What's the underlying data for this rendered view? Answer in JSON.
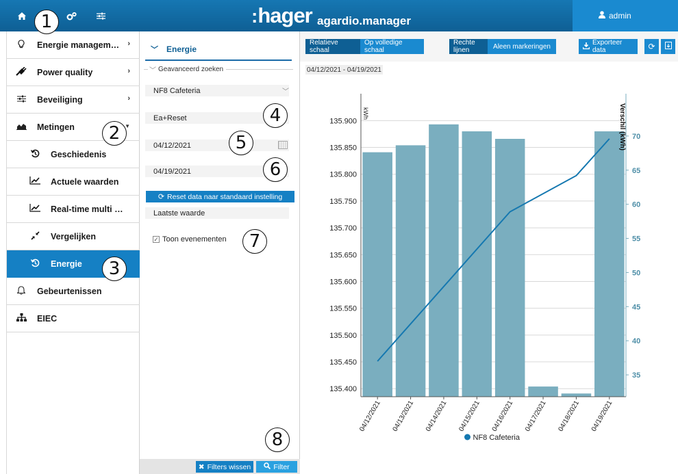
{
  "app": {
    "brand": "hager",
    "brand_colon": ":",
    "product": "agardio.manager",
    "user": "admin"
  },
  "topbar": {
    "icons": [
      "home-icon",
      "cogs-icon",
      "sliders-icon"
    ]
  },
  "sidebar": {
    "items": [
      {
        "label": "Energie managem…",
        "icon": "bulb-icon",
        "has_chevron": true
      },
      {
        "label": "Power quality",
        "icon": "plug-icon",
        "has_chevron": true
      },
      {
        "label": "Beveiliging",
        "icon": "sliders-icon",
        "has_chevron": true
      },
      {
        "label": "Metingen",
        "icon": "area-chart-icon",
        "has_chevron": true
      },
      {
        "label": "Geschiedenis",
        "icon": "history-icon"
      },
      {
        "label": "Actuele waarden",
        "icon": "line-chart-icon"
      },
      {
        "label": "Real-time multi …",
        "icon": "line-chart-icon"
      },
      {
        "label": "Vergelijken",
        "icon": "compress-icon"
      },
      {
        "label": "Energie",
        "icon": "history-icon",
        "active": true
      },
      {
        "label": "Gebeurtenissen",
        "icon": "bell-icon"
      },
      {
        "label": "EIEC",
        "icon": "sitemap-icon"
      }
    ]
  },
  "filter": {
    "title": "Energie",
    "advanced_search": "Geavanceerd zoeken",
    "device": "NF8 Cafeteria",
    "measure": "Ea+Reset",
    "start_date": "04/12/2021",
    "end_date": "04/19/2021",
    "reset_label": "Reset data naar standaard instelling",
    "value_mode": "Laatste waarde",
    "show_events_label": "Toon evenementen",
    "show_events_checked": true,
    "clear_label": "Filters wissen",
    "apply_label": "Filter"
  },
  "toolbar": {
    "relative_scale": "Relatieve schaal",
    "full_scale": "Op volledige schaal",
    "straight_lines": "Rechte lijnen",
    "markers_only": "Aleen markeringen",
    "export_label": "Exporteer data"
  },
  "date_range": "04/12/2021 - 04/19/2021",
  "callouts": [
    "1",
    "2",
    "3",
    "4",
    "5",
    "6",
    "7",
    "8"
  ],
  "colors": {
    "accent": "#1580c4",
    "bar": "#7aaebf",
    "line": "#1578b0"
  },
  "chart_data": {
    "type": "bar",
    "categories": [
      "04/12/2021",
      "04/13/2021",
      "04/14/2021",
      "04/15/2021",
      "04/16/2021",
      "04/17/2021",
      "04/18/2021",
      "04/19/2021"
    ],
    "ylabel": "kWh",
    "y2label": "Verschil (kWh)",
    "ylim": [
      135.385,
      135.94
    ],
    "yticks": [
      "135.400",
      "135.450",
      "135.500",
      "135.550",
      "135.600",
      "135.650",
      "135.700",
      "135.750",
      "135.800",
      "135.850",
      "135.900"
    ],
    "y2lim": [
      31.8,
      75.4
    ],
    "y2ticks": [
      "35",
      "40",
      "45",
      "50",
      "55",
      "60",
      "65",
      "70"
    ],
    "series": [
      {
        "name": "NF8 Cafeteria",
        "type": "bar",
        "values": [
          135.841,
          135.854,
          135.893,
          135.88,
          135.866,
          135.404,
          135.391,
          135.88
        ]
      },
      {
        "type": "line",
        "axis": "right",
        "values": [
          37.0,
          null,
          null,
          null,
          58.9,
          null,
          64.2,
          69.6
        ]
      }
    ],
    "legend": "bottom-center",
    "grid": true
  }
}
